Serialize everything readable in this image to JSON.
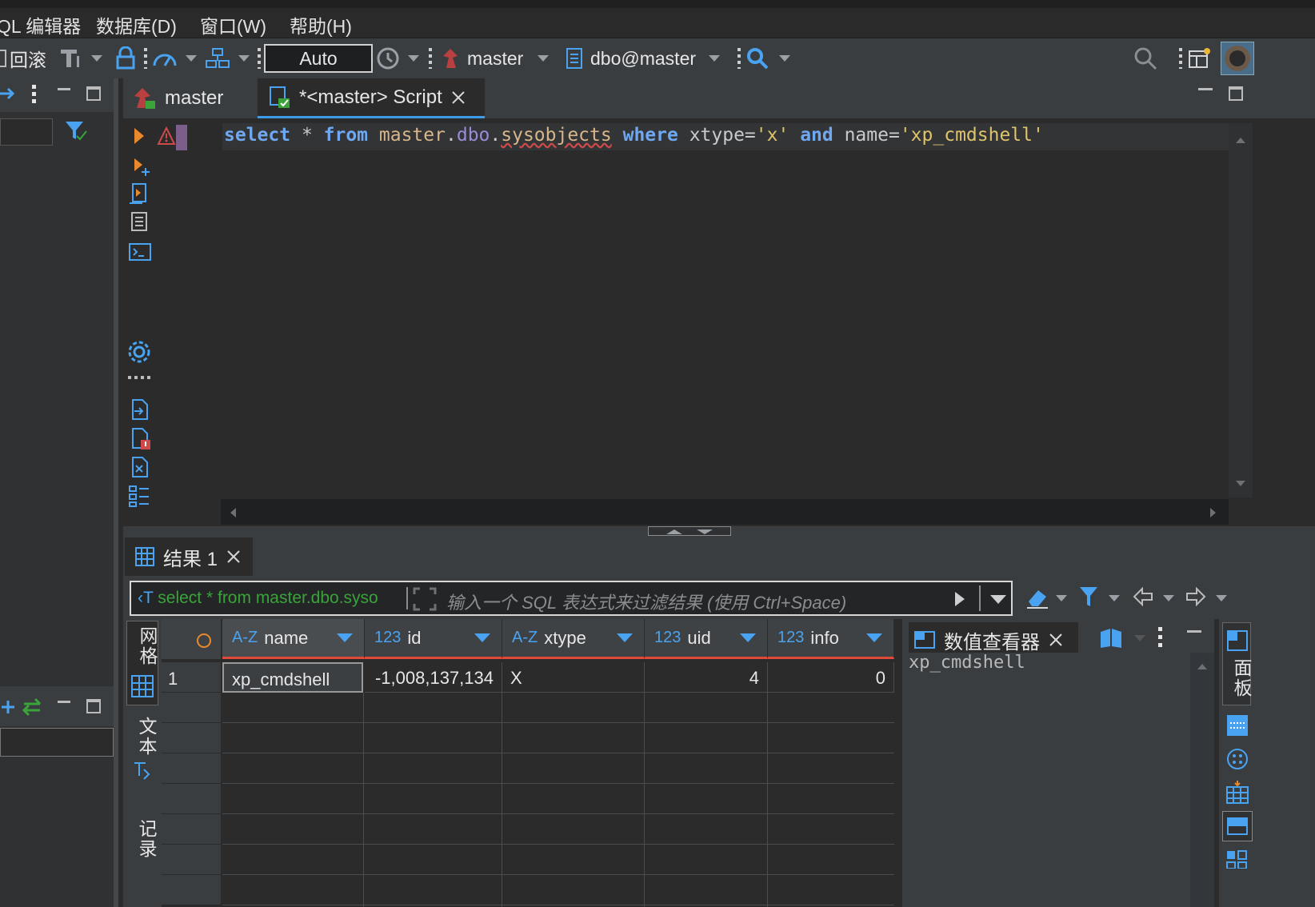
{
  "menu": {
    "items": [
      "QL 编辑器",
      "数据库(D)",
      "窗口(W)",
      "帮助(H)"
    ]
  },
  "toolbar": {
    "rollback_label": "回滚",
    "commit_mode": "Auto",
    "datasource": "master",
    "schema": "dbo@master"
  },
  "editor": {
    "tabs": [
      {
        "label": "master"
      },
      {
        "label": "*<master> Script"
      }
    ],
    "sql": {
      "t1": "select",
      "t2": " * ",
      "t3": "from",
      "t4": " ",
      "t5": "master",
      "t6": ".",
      "t7": "dbo",
      "t8": ".",
      "t9": "sysobjects",
      "t10": " ",
      "t11": "where",
      "t12": " xtype=",
      "t13": "'x'",
      "t14": " ",
      "t15": "and",
      "t16": " name=",
      "t17": "'xp_cmdshell'"
    }
  },
  "results": {
    "tab_label": "结果 1",
    "filter_query": "select * from master.dbo.syso",
    "filter_placeholder": "输入一个 SQL 表达式来过滤结果 (使用 Ctrl+Space)",
    "side_tabs": [
      "网格",
      "文本",
      "记录"
    ],
    "columns": [
      {
        "type": "A-Z",
        "name": "name"
      },
      {
        "type": "123",
        "name": "id"
      },
      {
        "type": "A-Z",
        "name": "xtype"
      },
      {
        "type": "123",
        "name": "uid"
      },
      {
        "type": "123",
        "name": "info"
      }
    ],
    "rows": [
      {
        "num": "1",
        "name": "xp_cmdshell",
        "id": "-1,008,137,134",
        "xtype": "X",
        "uid": "4",
        "info": "0"
      }
    ]
  },
  "viewer": {
    "title": "数值查看器",
    "value": "xp_cmdshell",
    "side_tab": "面板"
  },
  "colors": {
    "keyword": "#6fa8f0",
    "string": "#e0c46c",
    "accent": "#3d9be8",
    "header_underline": "#e04a3a",
    "filter_text": "#3aa33a"
  }
}
